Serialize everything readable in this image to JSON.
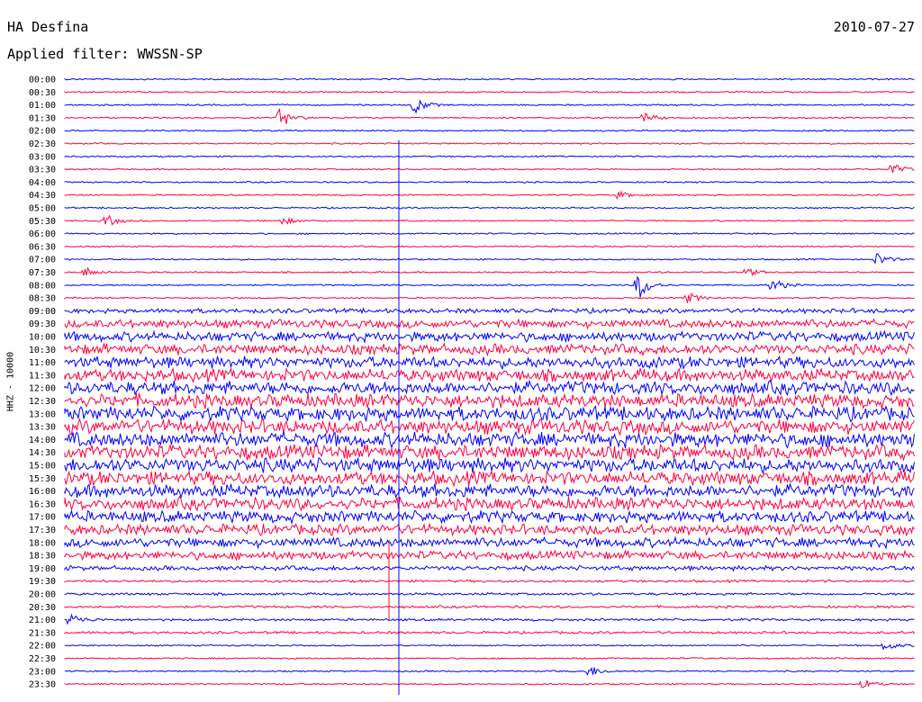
{
  "header": {
    "station": "HA Desfina",
    "date": "2010-07-27",
    "filter": "Applied filter: WWSSN-SP"
  },
  "axis_label": "HHZ - 10000",
  "colors": {
    "trace_a": "#0000ff",
    "trace_b": "#ff0040"
  },
  "chart_data": {
    "type": "line",
    "title": "HA Desfina",
    "ylabel": "HHZ - 10000",
    "row_labels": [
      "00:00",
      "00:30",
      "01:00",
      "01:30",
      "02:00",
      "02:30",
      "03:00",
      "03:30",
      "04:00",
      "04:30",
      "05:00",
      "05:30",
      "06:00",
      "06:30",
      "07:00",
      "07:30",
      "08:00",
      "08:30",
      "09:00",
      "09:30",
      "10:00",
      "10:30",
      "11:00",
      "11:30",
      "12:00",
      "12:30",
      "13:00",
      "13:30",
      "14:00",
      "14:30",
      "15:00",
      "15:30",
      "16:00",
      "16:30",
      "17:00",
      "17:30",
      "18:00",
      "18:30",
      "19:00",
      "19:30",
      "20:00",
      "20:30",
      "21:00",
      "21:30",
      "22:00",
      "22:30",
      "23:00",
      "23:30"
    ],
    "series": [
      {
        "colors_alternate": [
          "#0000ff",
          "#ff0040"
        ]
      }
    ],
    "grid": false
  }
}
